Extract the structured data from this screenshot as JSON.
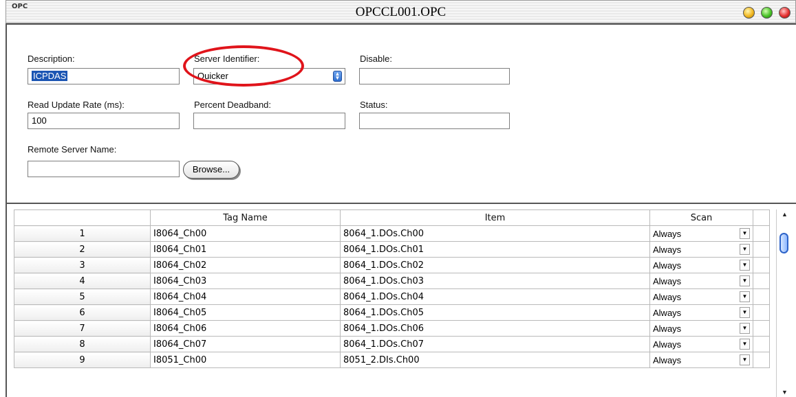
{
  "window": {
    "app_badge": "OPC",
    "title": "OPCCL001.OPC"
  },
  "form": {
    "description_label": "Description:",
    "description_value": "ICPDAS",
    "server_identifier_label": "Server Identifier:",
    "server_identifier_value": "Quicker",
    "disable_label": "Disable:",
    "disable_value": "",
    "read_update_rate_label": "Read Update Rate (ms):",
    "read_update_rate_value": "100",
    "percent_deadband_label": "Percent Deadband:",
    "percent_deadband_value": "",
    "status_label": "Status:",
    "status_value": "",
    "remote_server_name_label": "Remote Server Name:",
    "remote_server_name_value": "",
    "browse_label": "Browse..."
  },
  "table": {
    "headers": [
      "",
      "Tag Name",
      "Item",
      "Scan"
    ],
    "rows": [
      {
        "num": "1",
        "tag": "I8064_Ch00",
        "item": "8064_1.DOs.Ch00",
        "scan": "Always"
      },
      {
        "num": "2",
        "tag": "I8064_Ch01",
        "item": "8064_1.DOs.Ch01",
        "scan": "Always"
      },
      {
        "num": "3",
        "tag": "I8064_Ch02",
        "item": "8064_1.DOs.Ch02",
        "scan": "Always"
      },
      {
        "num": "4",
        "tag": "I8064_Ch03",
        "item": "8064_1.DOs.Ch03",
        "scan": "Always"
      },
      {
        "num": "5",
        "tag": "I8064_Ch04",
        "item": "8064_1.DOs.Ch04",
        "scan": "Always"
      },
      {
        "num": "6",
        "tag": "I8064_Ch05",
        "item": "8064_1.DOs.Ch05",
        "scan": "Always"
      },
      {
        "num": "7",
        "tag": "I8064_Ch06",
        "item": "8064_1.DOs.Ch06",
        "scan": "Always"
      },
      {
        "num": "8",
        "tag": "I8064_Ch07",
        "item": "8064_1.DOs.Ch07",
        "scan": "Always"
      },
      {
        "num": "9",
        "tag": "I8051_Ch00",
        "item": "8051_2.DIs.Ch00",
        "scan": "Always"
      }
    ]
  },
  "icons": {
    "close": "close-icon",
    "minimize": "minimize-icon",
    "zoom": "zoom-icon",
    "select_arrow": "updown-arrow-icon",
    "dropdown": "chevron-down-icon"
  },
  "colors": {
    "callout": "#e0141b",
    "selection": "#1b55b3",
    "scroll_thumb": "#2d63c8"
  }
}
